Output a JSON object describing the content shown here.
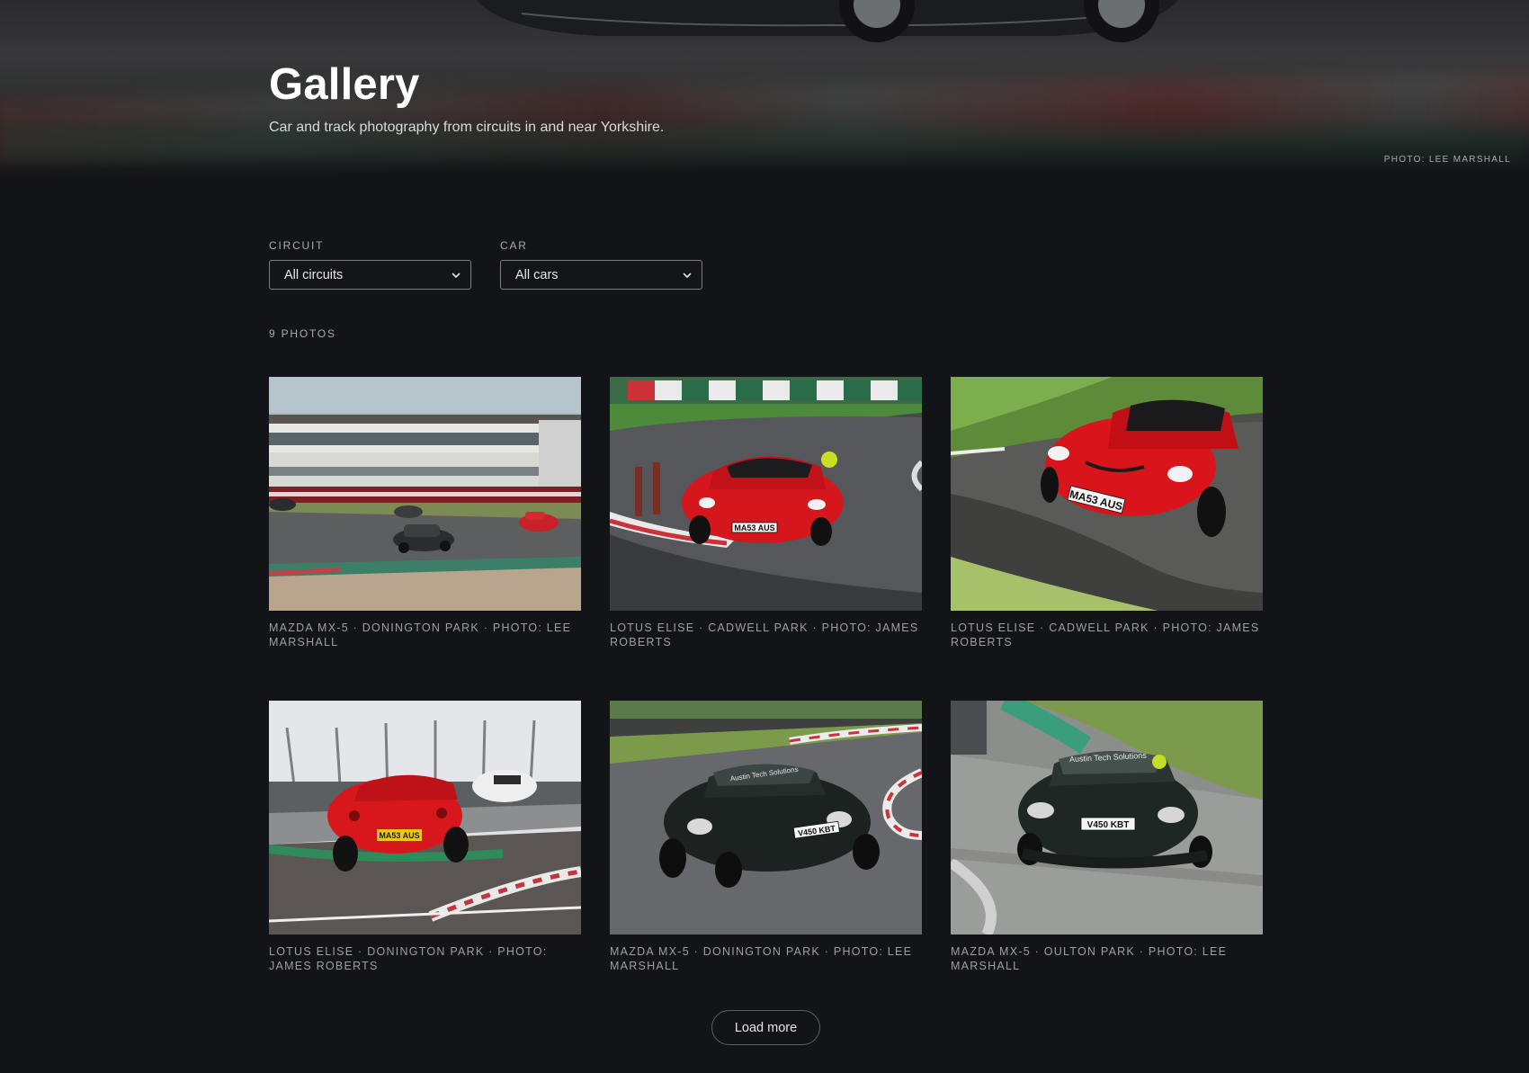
{
  "hero": {
    "title": "Gallery",
    "subtitle": "Car and track photography from circuits in and near Yorkshire.",
    "credit": "PHOTO: LEE MARSHALL"
  },
  "filters": {
    "circuit": {
      "label": "CIRCUIT",
      "selected": "All circuits"
    },
    "car": {
      "label": "CAR",
      "selected": "All cars"
    }
  },
  "photo_count": "9 PHOTOS",
  "photos": [
    {
      "caption": "MAZDA MX-5 · DONINGTON PARK · PHOTO: LEE MARSHALL",
      "plate": "",
      "car_color": "#2a2c2e"
    },
    {
      "caption": "LOTUS ELISE · CADWELL PARK · PHOTO: JAMES ROBERTS",
      "plate": "MA53 AUS",
      "car_color": "#d5161c"
    },
    {
      "caption": "LOTUS ELISE · CADWELL PARK · PHOTO: JAMES ROBERTS",
      "plate": "MA53 AUS",
      "car_color": "#d9141b"
    },
    {
      "caption": "LOTUS ELISE · DONINGTON PARK · PHOTO: JAMES ROBERTS",
      "plate": "MA53 AUS",
      "car_color": "#d8171d"
    },
    {
      "caption": "MAZDA MX-5 · DONINGTON PARK · PHOTO: LEE MARSHALL",
      "plate": "V450 KBT",
      "car_color": "#1c2220"
    },
    {
      "caption": "MAZDA MX-5 · OULTON PARK · PHOTO: LEE MARSHALL",
      "plate": "V450 KBT",
      "car_color": "#1f2724"
    }
  ],
  "load_more": "Load more"
}
